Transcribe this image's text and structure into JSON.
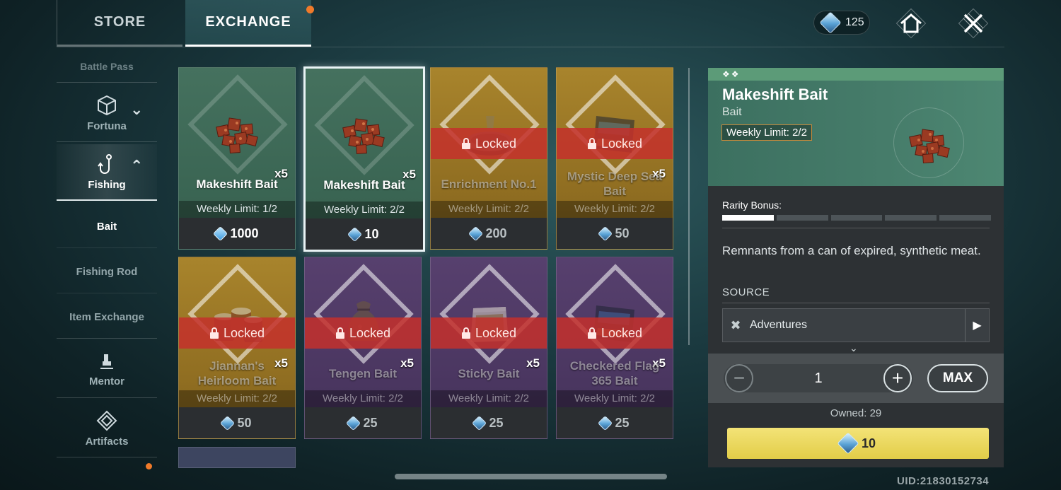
{
  "tabs": {
    "store": "STORE",
    "exchange": "EXCHANGE"
  },
  "currency": {
    "amount": "125",
    "icon": "crystal-gem-icon"
  },
  "top_icons": [
    "home-icon",
    "close-icon"
  ],
  "sidebar": {
    "items": [
      {
        "label": "Battle Pass",
        "icon": ""
      },
      {
        "label": "Fortuna",
        "icon": "cube-icon"
      },
      {
        "label": "Fishing",
        "icon": "fishing-hook-icon"
      },
      {
        "label": "Mentor",
        "icon": "mentor-icon"
      },
      {
        "label": "Artifacts",
        "icon": "artifacts-icon"
      }
    ],
    "sub_items": [
      "Bait",
      "Fishing Rod",
      "Item Exchange"
    ]
  },
  "grid": {
    "locked_text": "Locked",
    "cards": [
      {
        "name": "Makeshift Bait",
        "qty": "x5",
        "limit": "Weekly Limit: 1/2",
        "price": "1000",
        "rarity": "green",
        "locked": false,
        "selected": false,
        "currency": "blue-crystal",
        "art": "meat"
      },
      {
        "name": "Makeshift Bait",
        "qty": "x5",
        "limit": "Weekly Limit: 2/2",
        "price": "10",
        "rarity": "green",
        "locked": false,
        "selected": true,
        "currency": "crystal-gem",
        "art": "meat"
      },
      {
        "name": "Enrichment No.1",
        "qty": "",
        "limit": "Weekly Limit: 2/2",
        "price": "200",
        "rarity": "gold",
        "locked": true,
        "selected": false,
        "currency": "crystal-gem",
        "art": "tin"
      },
      {
        "name": "Mystic Deep Sea Bait",
        "qty": "x5",
        "limit": "Weekly Limit: 2/2",
        "price": "50",
        "rarity": "gold",
        "locked": true,
        "selected": false,
        "currency": "crystal-gem",
        "art": "bag"
      },
      {
        "name": "Jiannan's Heirloom Bait",
        "qty": "x5",
        "limit": "Weekly Limit: 2/2",
        "price": "50",
        "rarity": "gold",
        "locked": true,
        "selected": false,
        "currency": "crystal-gem",
        "art": "cans"
      },
      {
        "name": "Tengen Bait",
        "qty": "x5",
        "limit": "Weekly Limit: 2/2",
        "price": "25",
        "rarity": "purple",
        "locked": true,
        "selected": false,
        "currency": "crystal-gem",
        "art": "sack"
      },
      {
        "name": "Sticky Bait",
        "qty": "x5",
        "limit": "Weekly Limit: 2/2",
        "price": "25",
        "rarity": "purple",
        "locked": true,
        "selected": false,
        "currency": "crystal-gem",
        "art": "pouch"
      },
      {
        "name": "Checkered Flag 365 Bait",
        "qty": "x5",
        "limit": "Weekly Limit: 2/2",
        "price": "25",
        "rarity": "purple",
        "locked": true,
        "selected": false,
        "currency": "crystal-gem",
        "art": "bag"
      }
    ]
  },
  "detail": {
    "title": "Makeshift Bait",
    "category": "Bait",
    "limit": "Weekly Limit: 2/2",
    "rarity_label": "Rarity Bonus:",
    "rarity_level": 1,
    "rarity_max": 5,
    "description": "Remnants from a can of expired, synthetic meat.",
    "source_label": "SOURCE",
    "source": "Adventures",
    "quantity": "1",
    "max_label": "MAX",
    "owned": "Owned: 29",
    "buy_price": "10"
  },
  "uid": "UID:21830152734",
  "colors": {
    "green_card": "#3a6553",
    "gold_card": "#8f6d21",
    "purple_card": "#4a3660",
    "locked_band": "#c4302c",
    "buy_button": "#e8d65a",
    "notification_dot": "#f07a2a"
  }
}
